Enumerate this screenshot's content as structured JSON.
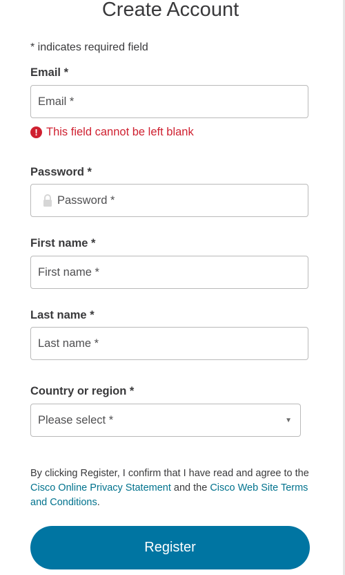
{
  "page": {
    "title": "Create Account",
    "required_note": "* indicates required field"
  },
  "email": {
    "label": "Email *",
    "placeholder": "Email *",
    "error": "This field cannot be left blank",
    "error_icon": "!"
  },
  "password": {
    "label": "Password *",
    "placeholder": "Password *",
    "icon": "lock-icon"
  },
  "first_name": {
    "label": "First name *",
    "placeholder": "First name *"
  },
  "last_name": {
    "label": "Last name *",
    "placeholder": "Last name *"
  },
  "country": {
    "label": "Country or region *",
    "placeholder": "Please select *",
    "caret": "▼"
  },
  "consent": {
    "text_1": "By clicking Register, I confirm that I have read and agree to the ",
    "link_privacy": "Cisco Online Privacy Statement",
    "text_2": " and the ",
    "link_terms": "Cisco Web Site Terms and Conditions",
    "text_3": "."
  },
  "actions": {
    "register_label": "Register"
  },
  "colors": {
    "accent": "#0075a2",
    "link": "#00728d",
    "error": "#cf2030"
  }
}
